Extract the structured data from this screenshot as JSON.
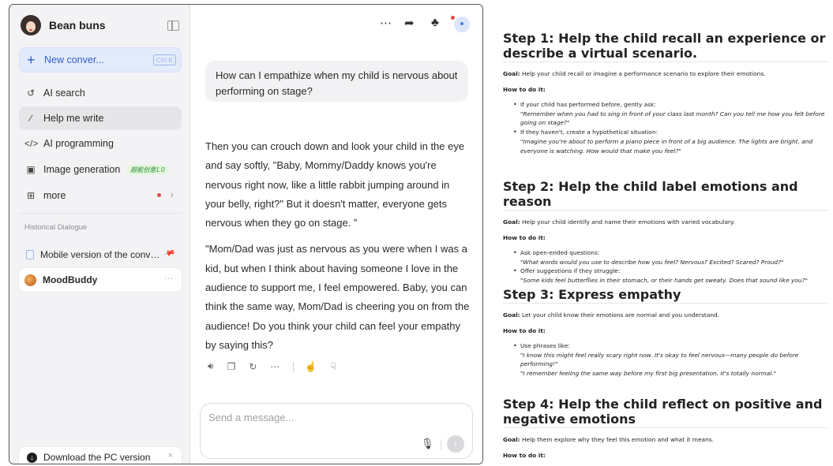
{
  "sidebar": {
    "brand": "Bean buns",
    "new_conversation": "New conver...",
    "shortcut": "Ctrl K",
    "items": [
      {
        "label": "AI search",
        "icon": "ai-search-icon"
      },
      {
        "label": "Help me write",
        "icon": "pen-icon"
      },
      {
        "label": "AI programming",
        "icon": "code-icon"
      },
      {
        "label": "Image generation",
        "icon": "image-icon",
        "badge": "超能创意1.0"
      },
      {
        "label": "more",
        "icon": "grid-icon"
      }
    ],
    "history_title": "Historical Dialogue",
    "history": [
      {
        "label": "Mobile version of the conversation"
      },
      {
        "label": "MoodBuddy"
      }
    ],
    "download": "Download the PC version"
  },
  "chat": {
    "user_message": "How can I empathize when my child is nervous about performing on stage?",
    "answer": [
      "Then you can crouch down and look your child in the eye and say softly, \"Baby, Mommy/Daddy knows you're nervous right now, like a little rabbit jumping around in your belly, right?\" But it doesn't matter, everyone gets nervous when they go on stage. ”",
      "\"Mom/Dad was just as nervous as you were when I was a kid, but when I think about having someone I love in the audience to support me, I feel empowered. Baby, you can think the same way, Mom/Dad is cheering you on from the audience! Do you think your child can feel your empathy by saying this?"
    ],
    "composer_placeholder": "Send a message..."
  },
  "doc": {
    "steps": [
      {
        "title": "Step 1: Help the child recall an experience or describe a virtual scenario.",
        "goal_label": "Goal:",
        "goal": "Help your child recall or imagine a performance scenario to explore their emotions.",
        "how": "How to do it:",
        "bullets": [
          {
            "text": "If your child has performed before, gently ask:",
            "quote": "\"Remember when you had to sing in front of your class last month? Can you tell me how you felt before going on stage?\""
          },
          {
            "text": "If they haven't, create a hypothetical situation:",
            "quote": "\"Imagine you're about to perform a piano piece in front of a big audience. The lights are bright, and everyone is watching. How would that make you feel?\""
          }
        ]
      },
      {
        "title": "Step 2: Help the child label emotions and reason",
        "goal_label": "Goal:",
        "goal": "Help your child identify and name their emotions with varied vocabulary.",
        "how": "How to do it:",
        "bullets": [
          {
            "text": "Ask open-ended questions:",
            "quote": "\"What words would you use to describe how you feel? Nervous? Excited? Scared? Proud?\""
          },
          {
            "text": "Offer suggestions if they struggle:",
            "quote": "\"Some kids feel butterflies in their stomach, or their hands get sweaty. Does that sound like you?\""
          }
        ]
      },
      {
        "title": "Step 3: Express empathy",
        "goal_label": "Goal:",
        "goal": "Let your child know their emotions are normal and you understand.",
        "how": "How to do it:",
        "bullets": [
          {
            "text": "Use phrases like:",
            "quote": "\"I know this might feel really scary right now. It's okay to feel nervous—many people do before performing!\"",
            "quote2": "\"I remember feeling the same way before my first big presentation. It's totally normal.\""
          }
        ]
      },
      {
        "title": "Step 4: Help the child reflect on positive and negative emotions",
        "goal_label": "Goal:",
        "goal": "Help them explore why they feel this emotion and what it means.",
        "how": "How to do it:"
      }
    ]
  }
}
